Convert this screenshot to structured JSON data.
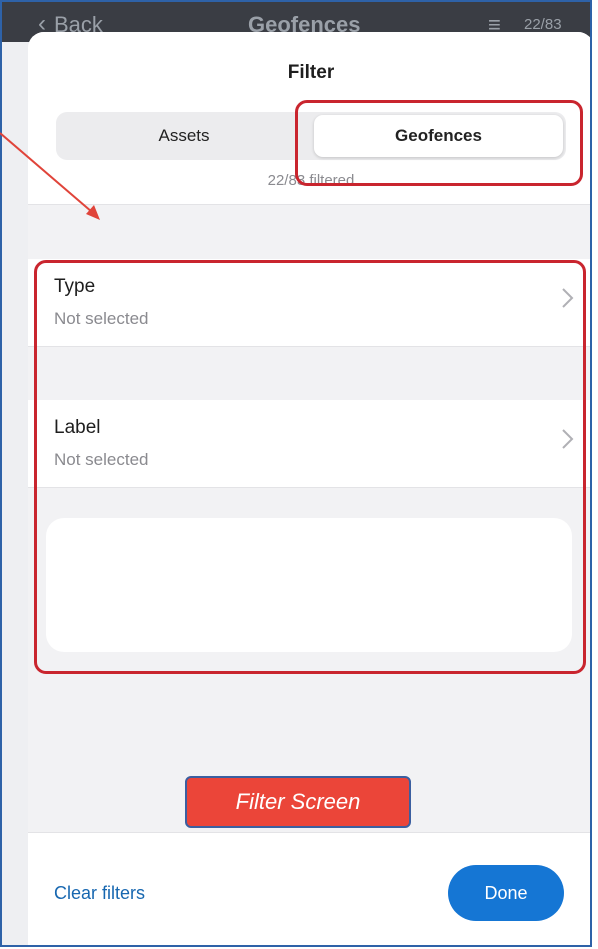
{
  "background_screen": {
    "back_label": "Back",
    "title": "Geofences",
    "count": "22/83"
  },
  "filter_sheet": {
    "title": "Filter",
    "tabs": [
      {
        "label": "Assets",
        "selected": false
      },
      {
        "label": "Geofences",
        "selected": true
      }
    ],
    "count_text": "22/83 filtered",
    "rows": [
      {
        "label": "Type",
        "value": "Not selected"
      },
      {
        "label": "Label",
        "value": "Not selected"
      }
    ],
    "footer": {
      "clear_label": "Clear filters",
      "done_label": "Done"
    }
  },
  "annotation": {
    "caption": "Filter Screen",
    "highlight_color": "#c9252e",
    "caption_color": "#eb4539"
  },
  "colors": {
    "accent": "#1576d4",
    "link": "#1767b0"
  }
}
